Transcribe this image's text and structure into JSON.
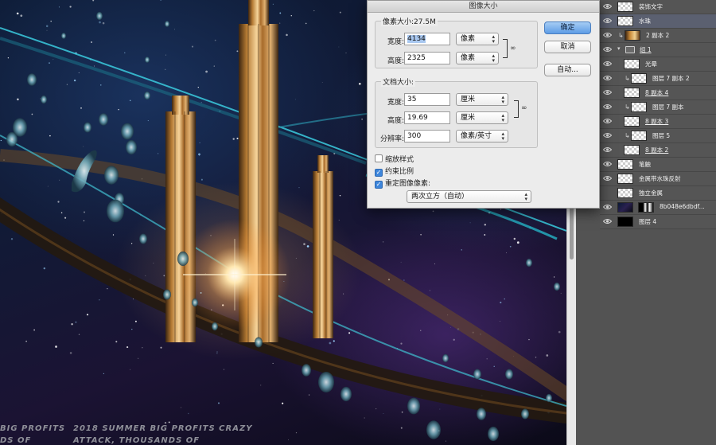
{
  "canvas": {
    "poster_line1_left": "BIG PROFITS",
    "poster_line2_left": "DS OF",
    "poster_line1": "2018 SUMMER BIG PROFITS CRAZY",
    "poster_line2": "ATTACK, THOUSANDS OF"
  },
  "dialog": {
    "title": "图像大小",
    "pixel_dimensions": {
      "label": "像素大小:27.5M",
      "width_label": "宽度:",
      "width_value": "4134",
      "width_unit": "像素",
      "height_label": "高度:",
      "height_value": "2325",
      "height_unit": "像素"
    },
    "document_size": {
      "label": "文档大小:",
      "width_label": "宽度:",
      "width_value": "35",
      "width_unit": "厘米",
      "height_label": "高度:",
      "height_value": "19.69",
      "height_unit": "厘米",
      "resolution_label": "分辨率:",
      "resolution_value": "300",
      "resolution_unit": "像素/英寸"
    },
    "options": {
      "scale_styles": "缩放样式",
      "scale_styles_checked": false,
      "constrain": "约束比例",
      "constrain_checked": true,
      "resample": "重定图像像素:",
      "resample_checked": true,
      "resample_method": "两次立方（自动）"
    },
    "buttons": {
      "ok": "确定",
      "cancel": "取消",
      "auto": "自动..."
    }
  },
  "layers": [
    {
      "name": "装饰文字",
      "thumb": "checker",
      "visible": true
    },
    {
      "name": "水珠",
      "thumb": "checker",
      "visible": true,
      "selected": true
    },
    {
      "name": "2 副本 2",
      "thumb": "image",
      "visible": true,
      "clipped": true
    },
    {
      "name": "组 1",
      "thumb": "folder",
      "visible": true,
      "group": true
    },
    {
      "name": "光晕",
      "thumb": "checker",
      "visible": true,
      "indent": true
    },
    {
      "name": "图层 7 副本 2",
      "thumb": "checker",
      "visible": true,
      "indent": true,
      "clipped": true
    },
    {
      "name": "8 副本 4",
      "thumb": "checker",
      "visible": true,
      "indent": true
    },
    {
      "name": "图层 7 副本",
      "thumb": "checker",
      "visible": true,
      "indent": true,
      "clipped": true
    },
    {
      "name": "8 副本 3",
      "thumb": "checker",
      "visible": true,
      "indent": true
    },
    {
      "name": "图层 5",
      "thumb": "checker",
      "visible": true,
      "indent": true,
      "clipped": true
    },
    {
      "name": "8 副本 2",
      "thumb": "checker",
      "visible": true,
      "indent": true
    },
    {
      "name": "笔触",
      "thumb": "checker",
      "visible": true
    },
    {
      "name": "金属带水珠反射",
      "thumb": "checker",
      "visible": true
    },
    {
      "name": "独立金属",
      "thumb": "checker",
      "visible": false
    },
    {
      "name": "8b048e6dbdf...",
      "thumb": "dark",
      "visible": true,
      "mask": true
    },
    {
      "name": "图层 4",
      "thumb": "black",
      "visible": true
    }
  ]
}
